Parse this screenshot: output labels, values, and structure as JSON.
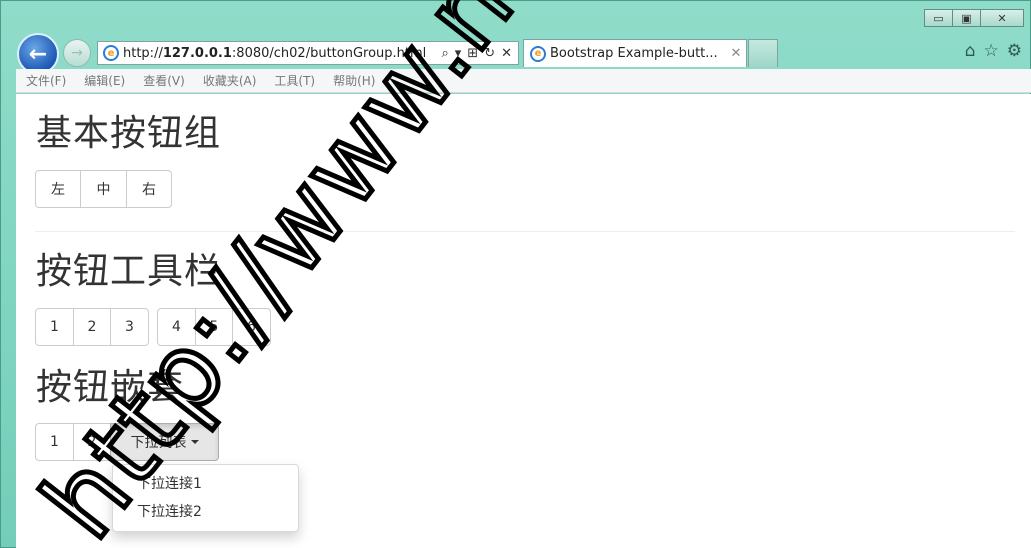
{
  "window": {
    "controls": {
      "minimize": "▭",
      "maximize": "▣",
      "close": "✕"
    }
  },
  "nav": {
    "back_icon": "←",
    "forward_icon": "→",
    "address": {
      "prefix": "http://",
      "host": "127.0.0.1",
      "rest": ":8080/ch02/buttonGroup.html"
    },
    "address_icons": {
      "search": "⌕",
      "dropdown": "▾",
      "compat": "⊞",
      "refresh": "↻",
      "stop": "✕"
    },
    "tab": {
      "label": "Bootstrap Example-butt...",
      "close": "✕"
    },
    "tools": {
      "home": "⌂",
      "favorites": "☆",
      "settings": "⚙"
    }
  },
  "menubar": {
    "items": [
      "文件(F)",
      "编辑(E)",
      "查看(V)",
      "收藏夹(A)",
      "工具(T)",
      "帮助(H)"
    ]
  },
  "page": {
    "section1": {
      "title": "基本按钮组",
      "buttons": [
        "左",
        "中",
        "右"
      ]
    },
    "section2": {
      "title": "按钮工具栏",
      "group1": [
        "1",
        "2",
        "3"
      ],
      "group2": [
        "4",
        "5",
        "6"
      ]
    },
    "section3": {
      "title": "按钮嵌套",
      "buttons": [
        "1",
        "2"
      ],
      "dropdown_label": "下拉列表",
      "dropdown_items": [
        "下拉连接1",
        "下拉连接2"
      ]
    }
  },
  "watermark": {
    "text": "http://www.ne"
  }
}
